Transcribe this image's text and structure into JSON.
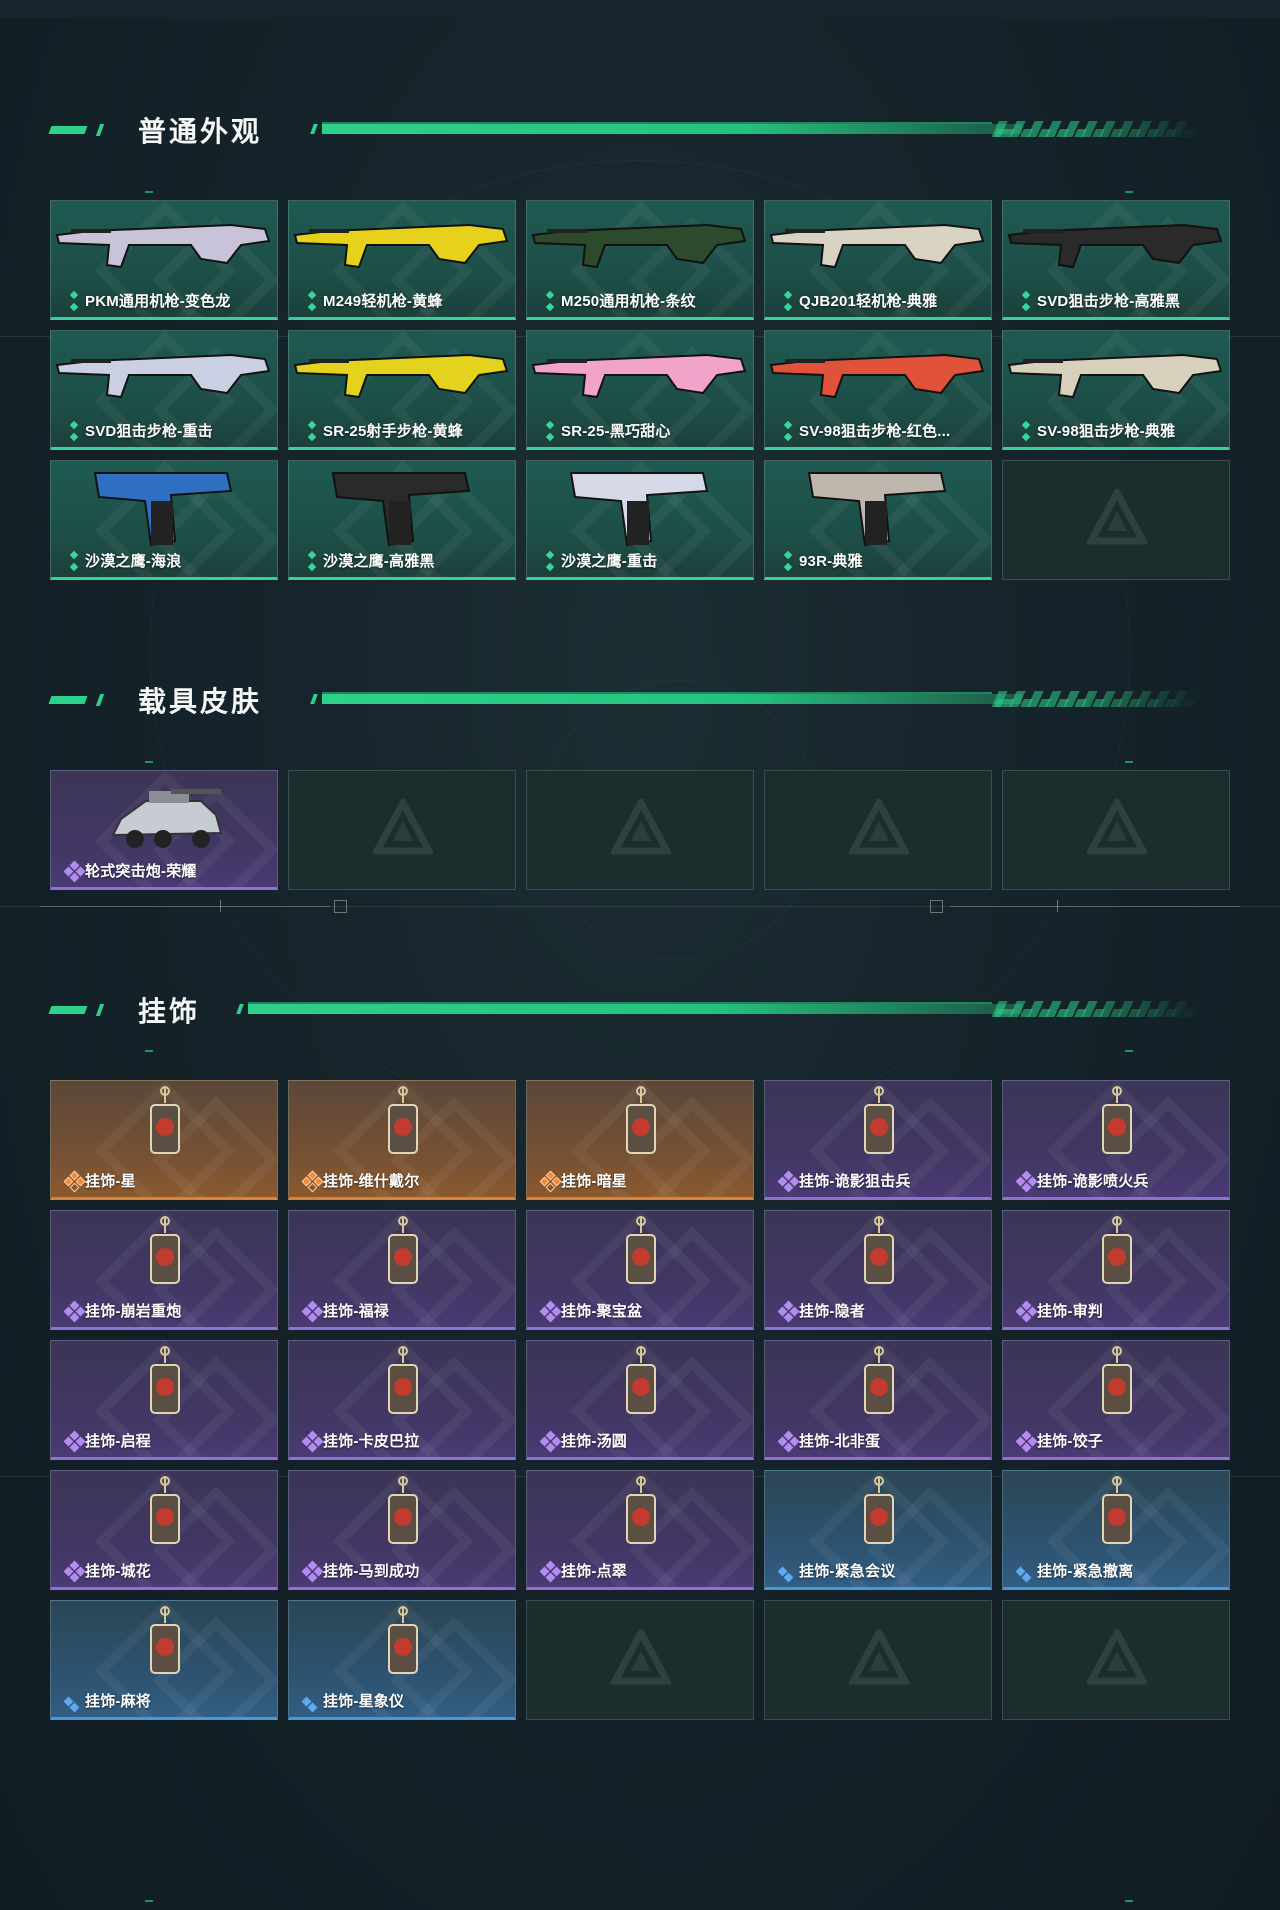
{
  "sections": {
    "weapons": {
      "title": "普通外观",
      "items": [
        {
          "label": "PKM通用机枪-变色龙",
          "icon": "machine-gun-icon",
          "rarity": "green"
        },
        {
          "label": "M249轻机枪-黄蜂",
          "icon": "machine-gun-icon",
          "rarity": "green"
        },
        {
          "label": "M250通用机枪-条纹",
          "icon": "machine-gun-icon",
          "rarity": "green"
        },
        {
          "label": "QJB201轻机枪-典雅",
          "icon": "machine-gun-icon",
          "rarity": "green"
        },
        {
          "label": "SVD狙击步枪-高雅黑",
          "icon": "sniper-rifle-icon",
          "rarity": "green"
        },
        {
          "label": "SVD狙击步枪-重击",
          "icon": "sniper-rifle-icon",
          "rarity": "green"
        },
        {
          "label": "SR-25射手步枪-黄蜂",
          "icon": "rifle-icon",
          "rarity": "green"
        },
        {
          "label": "SR-25-黑巧甜心",
          "icon": "rifle-icon",
          "rarity": "green"
        },
        {
          "label": "SV-98狙击步枪-红色...",
          "icon": "sniper-rifle-icon",
          "rarity": "green"
        },
        {
          "label": "SV-98狙击步枪-典雅",
          "icon": "sniper-rifle-icon",
          "rarity": "green"
        },
        {
          "label": "沙漠之鹰-海浪",
          "icon": "pistol-icon",
          "rarity": "green"
        },
        {
          "label": "沙漠之鹰-高雅黑",
          "icon": "pistol-icon",
          "rarity": "green"
        },
        {
          "label": "沙漠之鹰-重击",
          "icon": "pistol-icon",
          "rarity": "green"
        },
        {
          "label": "93R-典雅",
          "icon": "pistol-icon",
          "rarity": "green"
        }
      ]
    },
    "vehicles": {
      "title": "载具皮肤",
      "items": [
        {
          "label": "轮式突击炮-荣耀",
          "icon": "armored-vehicle-icon",
          "rarity": "purple"
        }
      ]
    },
    "charms": {
      "title": "挂饰",
      "items": [
        {
          "label": "挂饰-星",
          "icon": "charm-icon",
          "rarity": "orange"
        },
        {
          "label": "挂饰-维什戴尔",
          "icon": "charm-icon",
          "rarity": "orange"
        },
        {
          "label": "挂饰-暗星",
          "icon": "charm-icon",
          "rarity": "orange"
        },
        {
          "label": "挂饰-诡影狙击兵",
          "icon": "charm-icon",
          "rarity": "purple"
        },
        {
          "label": "挂饰-诡影喷火兵",
          "icon": "charm-icon",
          "rarity": "purple"
        },
        {
          "label": "挂饰-崩岩重炮",
          "icon": "charm-icon",
          "rarity": "purple"
        },
        {
          "label": "挂饰-福禄",
          "icon": "charm-icon",
          "rarity": "purple"
        },
        {
          "label": "挂饰-聚宝盆",
          "icon": "charm-icon",
          "rarity": "purple"
        },
        {
          "label": "挂饰-隐者",
          "icon": "charm-icon",
          "rarity": "purple"
        },
        {
          "label": "挂饰-审判",
          "icon": "charm-icon",
          "rarity": "purple"
        },
        {
          "label": "挂饰-启程",
          "icon": "charm-icon",
          "rarity": "purple"
        },
        {
          "label": "挂饰-卡皮巴拉",
          "icon": "charm-icon",
          "rarity": "purple"
        },
        {
          "label": "挂饰-汤圆",
          "icon": "charm-icon",
          "rarity": "purple"
        },
        {
          "label": "挂饰-北非蛋",
          "icon": "charm-icon",
          "rarity": "purple"
        },
        {
          "label": "挂饰-饺子",
          "icon": "charm-icon",
          "rarity": "purple"
        },
        {
          "label": "挂饰-城花",
          "icon": "charm-icon",
          "rarity": "purple"
        },
        {
          "label": "挂饰-马到成功",
          "icon": "charm-icon",
          "rarity": "purple"
        },
        {
          "label": "挂饰-点翠",
          "icon": "charm-icon",
          "rarity": "purple"
        },
        {
          "label": "挂饰-紧急会议",
          "icon": "charm-icon",
          "rarity": "blue"
        },
        {
          "label": "挂饰-紧急撤离",
          "icon": "charm-icon",
          "rarity": "blue"
        },
        {
          "label": "挂饰-麻将",
          "icon": "charm-icon",
          "rarity": "blue"
        },
        {
          "label": "挂饰-星象仪",
          "icon": "charm-icon",
          "rarity": "blue"
        }
      ]
    }
  },
  "colors": {
    "accent": "#2ed18a",
    "green": "#35d39a",
    "purple": "#9170d6",
    "orange": "#d9823a",
    "blue": "#4d97d6"
  }
}
